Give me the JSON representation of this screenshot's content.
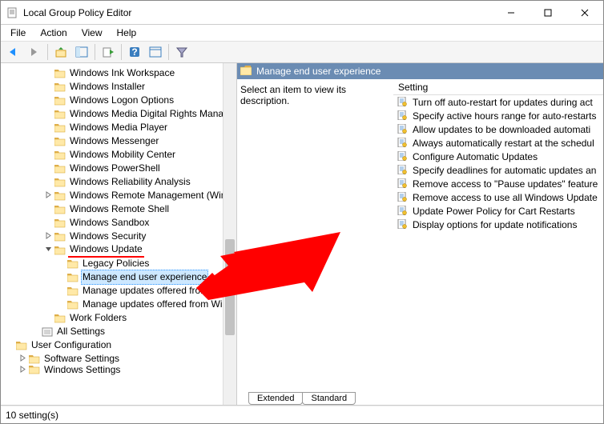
{
  "window": {
    "title": "Local Group Policy Editor"
  },
  "menus": {
    "file": "File",
    "action": "Action",
    "view": "View",
    "help": "Help"
  },
  "tree": {
    "items": [
      {
        "label": "Windows Ink Workspace",
        "depth": 3
      },
      {
        "label": "Windows Installer",
        "depth": 3
      },
      {
        "label": "Windows Logon Options",
        "depth": 3
      },
      {
        "label": "Windows Media Digital Rights Manage",
        "depth": 3
      },
      {
        "label": "Windows Media Player",
        "depth": 3
      },
      {
        "label": "Windows Messenger",
        "depth": 3
      },
      {
        "label": "Windows Mobility Center",
        "depth": 3
      },
      {
        "label": "Windows PowerShell",
        "depth": 3
      },
      {
        "label": "Windows Reliability Analysis",
        "depth": 3
      },
      {
        "label": "Windows Remote Management (WinR",
        "depth": 3,
        "expander": ">"
      },
      {
        "label": "Windows Remote Shell",
        "depth": 3
      },
      {
        "label": "Windows Sandbox",
        "depth": 3
      },
      {
        "label": "Windows Security",
        "depth": 3,
        "expander": ">"
      },
      {
        "label": "Windows Update",
        "depth": 3,
        "expander": "v",
        "underline": true
      },
      {
        "label": "Legacy Policies",
        "depth": 4
      },
      {
        "label": "Manage end user experience",
        "depth": 4,
        "selected": true,
        "underline": true
      },
      {
        "label": "Manage updates offered from Win",
        "depth": 4
      },
      {
        "label": "Manage updates offered from Win",
        "depth": 4
      },
      {
        "label": "Work Folders",
        "depth": 3
      },
      {
        "label": "All Settings",
        "depth": 2,
        "iconType": "settings"
      },
      {
        "label": "User Configuration",
        "depth": 0
      },
      {
        "label": "Software Settings",
        "depth": 1,
        "expander": ">"
      },
      {
        "label": "Windows Settings",
        "depth": 1,
        "expander": ">",
        "cut": true
      }
    ]
  },
  "rightPane": {
    "title": "Manage end user experience",
    "description": "Select an item to view its description.",
    "columnHeader": "Setting",
    "settings": [
      "Turn off auto-restart for updates during act",
      "Specify active hours range for auto-restarts",
      "Allow updates to be downloaded automati",
      "Always automatically restart at the schedul",
      "Configure Automatic Updates",
      "Specify deadlines for automatic updates an",
      "Remove access to \"Pause updates\" feature",
      "Remove access to use all Windows Update",
      "Update Power Policy for Cart Restarts",
      "Display options for update notifications"
    ]
  },
  "tabs": {
    "extended": "Extended",
    "standard": "Standard"
  },
  "status": {
    "text": "10 setting(s)"
  }
}
